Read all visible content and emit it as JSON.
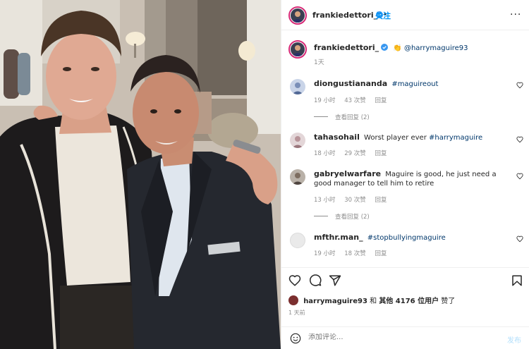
{
  "header": {
    "username": "frankiedettori_",
    "follow_label": "关注",
    "more_label": "···"
  },
  "caption": {
    "username": "frankiedettori_",
    "emoji": "👏",
    "mention": "@harrymaguire93",
    "time": "1天"
  },
  "comments": [
    {
      "username": "diongustiananda",
      "text": "#maguireout",
      "time": "19 小时",
      "likes": "43 次赞",
      "reply": "回复",
      "view_replies": "查看回复 (2)"
    },
    {
      "username": "tahasohail",
      "text_plain": "Worst player ever ",
      "text_tag": "#harrymaguire",
      "time": "18 小时",
      "likes": "29 次赞",
      "reply": "回复"
    },
    {
      "username": "gabryelwarfare",
      "text": "Maguire is good, he just need a good manager to tell him to retire",
      "time": "13 小时",
      "likes": "30 次赞",
      "reply": "回复",
      "view_replies": "查看回复 (2)"
    },
    {
      "username": "mfthr.man_",
      "text": "#stopbullyingmaguire",
      "time": "19 小时",
      "likes": "18 次赞",
      "reply": "回复"
    }
  ],
  "likes": {
    "liker": "harrymaguire93",
    "and": " 和 ",
    "others": "其他 4176 位用户",
    "suffix": " 赞了"
  },
  "post_time": "1 天前",
  "add_comment": {
    "placeholder": "添加评论...",
    "post_label": "发布"
  },
  "colors": {
    "accent": "#0095f6",
    "link": "#00376b",
    "secondary_text": "#8e8e8e",
    "verified": "#3897f0"
  },
  "icons": [
    "heart-icon",
    "comment-icon",
    "share-icon",
    "bookmark-icon",
    "emoji-icon",
    "verified-badge-icon",
    "more-icon"
  ]
}
